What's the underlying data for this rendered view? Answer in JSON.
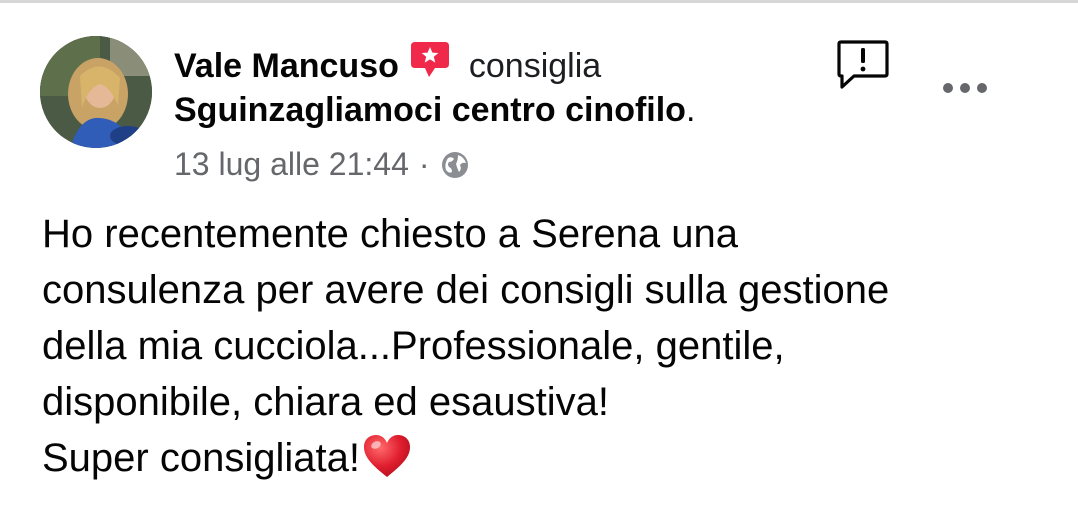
{
  "post": {
    "author": "Vale Mancuso",
    "action": "consiglia",
    "page_name": "Sguinzagliamoci centro cinofilo",
    "page_name_suffix": ".",
    "timestamp": "13 lug alle 21:44",
    "separator": "·",
    "privacy_icon": "globe-icon",
    "badge_icon": "recommendation-star-icon",
    "badge_color": "#f02849",
    "text_lines": [
      "Ho recentemente chiesto a Serena una",
      "consulenza per avere dei consigli sulla gestione",
      "della mia cucciola...Professionale, gentile,",
      "disponibile, chiara ed esaustiva!",
      "Super consigliata!"
    ],
    "trailing_emoji": "red-heart-icon"
  },
  "controls": {
    "report_icon": "report-icon",
    "more_icon": "more-options-icon"
  }
}
